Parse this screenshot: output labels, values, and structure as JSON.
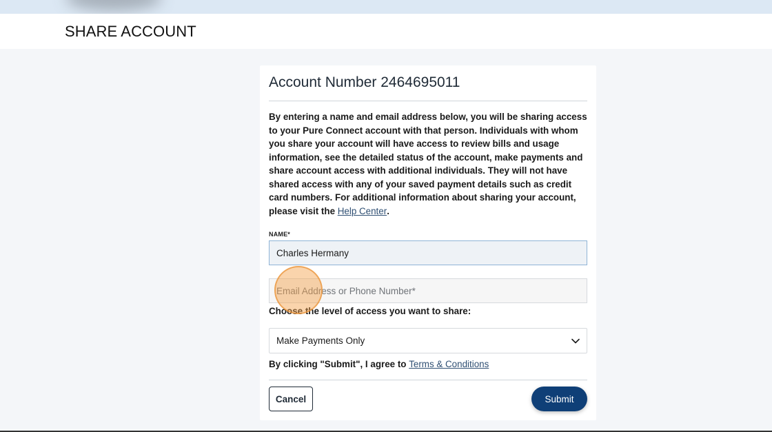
{
  "header": {
    "title": "SHARE ACCOUNT"
  },
  "card": {
    "title": "Account Number 2464695011",
    "intro_text": "By entering a name and email address below, you will be sharing access to your Pure Connect account with that person. Individuals with whom you share your account will have access to review bills and usage information, see the detailed status of the account, make payments and share account access with additional individuals. They will not have shared access with any of your saved payment details such as credit card numbers. For additional information about sharing your account, please visit the ",
    "help_link": "Help Center",
    "intro_end": "."
  },
  "form": {
    "name_label": "NAME*",
    "name_value": "Charles Hermany",
    "contact_placeholder": "Email Address or Phone Number*",
    "access_question": "Choose the level of access you want to share:",
    "access_selected": "Make Payments Only",
    "agree_text": "By clicking \"Submit\", I agree to ",
    "terms_link": "Terms & Conditions"
  },
  "buttons": {
    "cancel": "Cancel",
    "submit": "Submit"
  },
  "colors": {
    "page_background": "#f4f6f9",
    "primary": "#0f3f77",
    "link": "#2f4f73",
    "click_marker": "#f5a046"
  },
  "icons": {
    "select_arrow": "chevron-down-icon"
  }
}
